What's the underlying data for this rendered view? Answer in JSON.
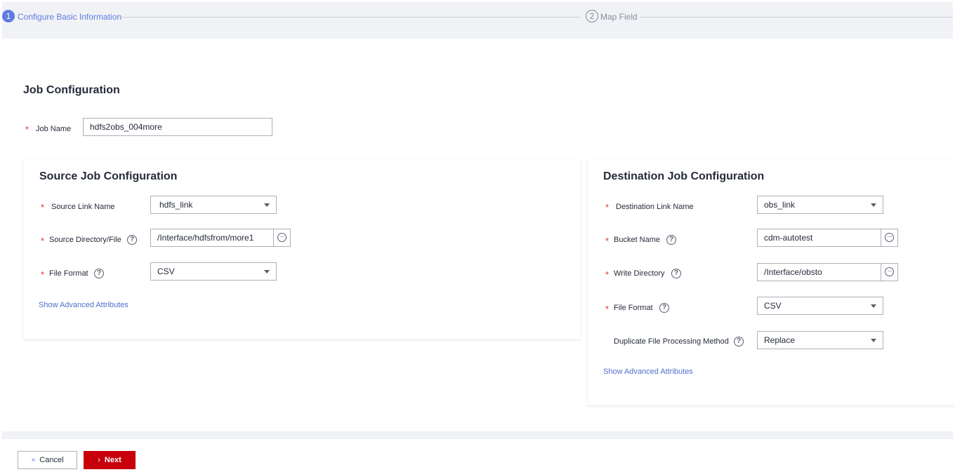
{
  "steps": [
    {
      "number": "1",
      "label": "Configure Basic Information",
      "state": "active"
    },
    {
      "number": "2",
      "label": "Map Field",
      "state": "inactive"
    }
  ],
  "job_config": {
    "title": "Job Configuration",
    "job_name_label": "Job Name",
    "job_name_value": "hdfs2obs_004more"
  },
  "source": {
    "title": "Source Job Configuration",
    "link_name_label": "Source Link Name",
    "link_name_value": "hdfs_link",
    "directory_label": "Source Directory/File",
    "directory_value": "/Interface/hdfsfrom/more1",
    "file_format_label": "File Format",
    "file_format_value": "CSV",
    "advanced_link": "Show Advanced Attributes"
  },
  "destination": {
    "title": "Destination Job Configuration",
    "link_name_label": "Destination Link Name",
    "link_name_value": "obs_link",
    "bucket_label": "Bucket Name",
    "bucket_value": "cdm-autotest",
    "write_dir_label": "Write Directory",
    "write_dir_value": "/Interface/obsto",
    "file_format_label": "File Format",
    "file_format_value": "CSV",
    "duplicate_label": "Duplicate File Processing Method",
    "duplicate_value": "Replace",
    "advanced_link": "Show Advanced Attributes"
  },
  "footer": {
    "cancel_label": "Cancel",
    "next_label": "Next"
  },
  "symbols": {
    "required": "*",
    "help": "?",
    "cancel_icon": "×",
    "next_icon": "›",
    "browse_icon": "···"
  },
  "colors": {
    "accent": "#5e7ce0",
    "primary_button": "#c7000b",
    "link": "#526ecc",
    "required": "#e0352b"
  }
}
